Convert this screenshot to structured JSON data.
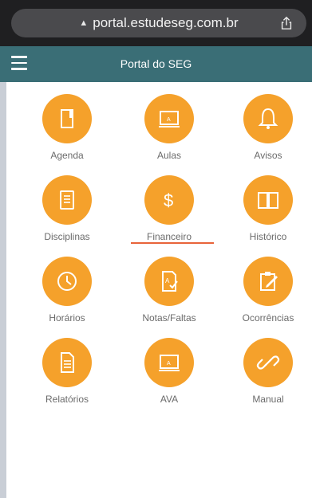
{
  "browser": {
    "url": "portal.estudeseg.com.br",
    "lock_glyph": "▲",
    "share_icon": "share-icon"
  },
  "header": {
    "title": "Portal do SEG",
    "menu_icon": "hamburger-icon",
    "color": "#3a6e76"
  },
  "colors": {
    "accent": "#f5a12b",
    "active_underline": "#e8633a"
  },
  "menu": {
    "items": [
      {
        "label": "Agenda",
        "icon": "agenda-icon"
      },
      {
        "label": "Aulas",
        "icon": "aulas-icon"
      },
      {
        "label": "Avisos",
        "icon": "bell-icon"
      },
      {
        "label": "Disciplinas",
        "icon": "notebook-icon"
      },
      {
        "label": "Financeiro",
        "icon": "dollar-icon",
        "active": true
      },
      {
        "label": "Histórico",
        "icon": "book-icon"
      },
      {
        "label": "Horários",
        "icon": "clock-icon"
      },
      {
        "label": "Notas/Faltas",
        "icon": "grades-icon"
      },
      {
        "label": "Ocorrências",
        "icon": "clipboard-edit-icon"
      },
      {
        "label": "Relatórios",
        "icon": "document-icon"
      },
      {
        "label": "AVA",
        "icon": "ava-icon"
      },
      {
        "label": "Manual",
        "icon": "link-icon"
      }
    ]
  }
}
